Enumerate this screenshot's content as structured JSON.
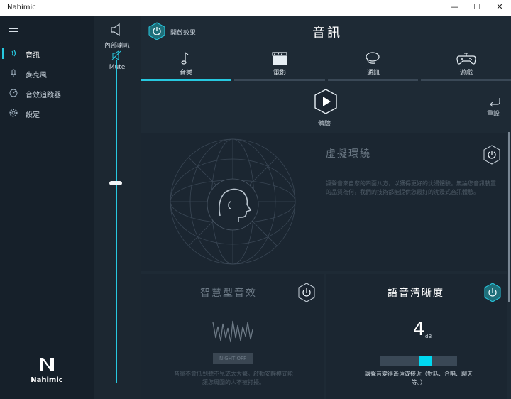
{
  "window": {
    "title": "Nahimic",
    "minimize": "—",
    "maximize": "☐",
    "close": "✕"
  },
  "sidebar": {
    "items": [
      {
        "label": "音訊",
        "icon": "audio-wave-icon",
        "active": true
      },
      {
        "label": "麥克風",
        "icon": "microphone-icon",
        "active": false
      },
      {
        "label": "音效追蹤器",
        "icon": "sound-tracker-icon",
        "active": false
      },
      {
        "label": "設定",
        "icon": "gear-icon",
        "active": false
      }
    ],
    "logo_text": "Nahimic"
  },
  "volume": {
    "device": "內部喇叭",
    "mute_label": "Mute",
    "level": 0.62
  },
  "header": {
    "effect_label": "開啟效果",
    "title": "音訊"
  },
  "tabs": [
    {
      "label": "音樂",
      "icon": "music-note-icon",
      "active": true
    },
    {
      "label": "電影",
      "icon": "clapperboard-icon",
      "active": false
    },
    {
      "label": "通訊",
      "icon": "chat-bubbles-icon",
      "active": false
    },
    {
      "label": "遊戲",
      "icon": "gamepad-icon",
      "active": false
    }
  ],
  "toolbar": {
    "play_label": "體驗",
    "reset_label": "重設"
  },
  "virtual_surround": {
    "title": "虛擬環繞",
    "description": "讓聲音來自您的四面八方，以獲得更好的沈浸體驗。無論您音訊裝置的品質為何，我們的技術都能提供您最好的沈浸式音訊體驗。"
  },
  "smart_volume": {
    "title": "智慧型音效",
    "night_button": "NIGHT OFF",
    "description": "音量不會低到聽不見或太大聲。啟動安靜模式能讓您周圍的人不被打擾。"
  },
  "voice_clarity": {
    "title": "語音清晰度",
    "value": "4",
    "unit": "dB",
    "level": 0.5,
    "description": "讓聲音變得遙遠或接近（對話、合唱、聊天等。）"
  },
  "colors": {
    "accent": "#27c8e0",
    "clarity_fill": "#00d8f0",
    "bg": "#1e2a35"
  }
}
